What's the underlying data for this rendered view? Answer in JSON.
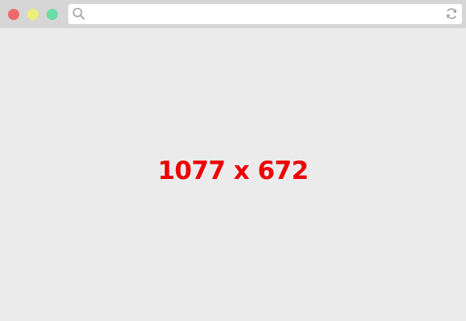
{
  "window": {
    "controls": [
      {
        "name": "close",
        "color": "#ee6a6a"
      },
      {
        "name": "minimize",
        "color": "#eeee7a"
      },
      {
        "name": "maximize",
        "color": "#6adca6"
      }
    ],
    "titlebar_color": "#d6d6d6",
    "background_color": "#ebebeb"
  },
  "addressbar": {
    "value": "",
    "placeholder": "",
    "left_icon": "search-icon",
    "right_icon": "refresh-icon",
    "icon_color": "#a0a0a0"
  },
  "content": {
    "dimension_text": "1077 x 672",
    "text_color": "#ee0000"
  }
}
